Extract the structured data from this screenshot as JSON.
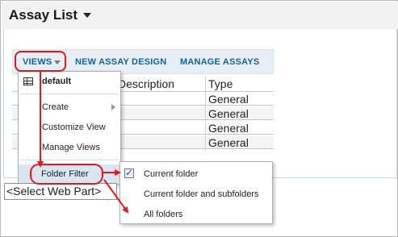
{
  "header": {
    "title": "Assay List"
  },
  "toolbar": {
    "views_label": "VIEWS",
    "new_design_label": "NEW ASSAY DESIGN",
    "manage_label": "MANAGE ASSAYS"
  },
  "grid": {
    "columns": [
      "Description",
      "Type"
    ],
    "rows": [
      {
        "description": "",
        "type": "General"
      },
      {
        "description": "",
        "type": "General"
      },
      {
        "description": "",
        "type": "General"
      },
      {
        "description": "",
        "type": "General"
      }
    ]
  },
  "views_menu": {
    "items": [
      {
        "label": "default",
        "icon": "grid-icon"
      },
      {
        "label": "Create",
        "has_submenu": true
      },
      {
        "label": "Customize View"
      },
      {
        "label": "Manage Views"
      },
      {
        "label": "Folder Filter",
        "has_submenu": true
      }
    ]
  },
  "folder_filter_menu": {
    "items": [
      {
        "label": "Current folder",
        "checked": true
      },
      {
        "label": "Current folder and subfolders",
        "checked": false
      },
      {
        "label": "All folders",
        "checked": false
      }
    ]
  },
  "select_webpart": {
    "value": "<Select Web Part>"
  },
  "colors": {
    "link": "#126495",
    "annotation": "#e0191f",
    "buttonbar": "#e8eef5",
    "header_bg": "#f2f2f2"
  }
}
